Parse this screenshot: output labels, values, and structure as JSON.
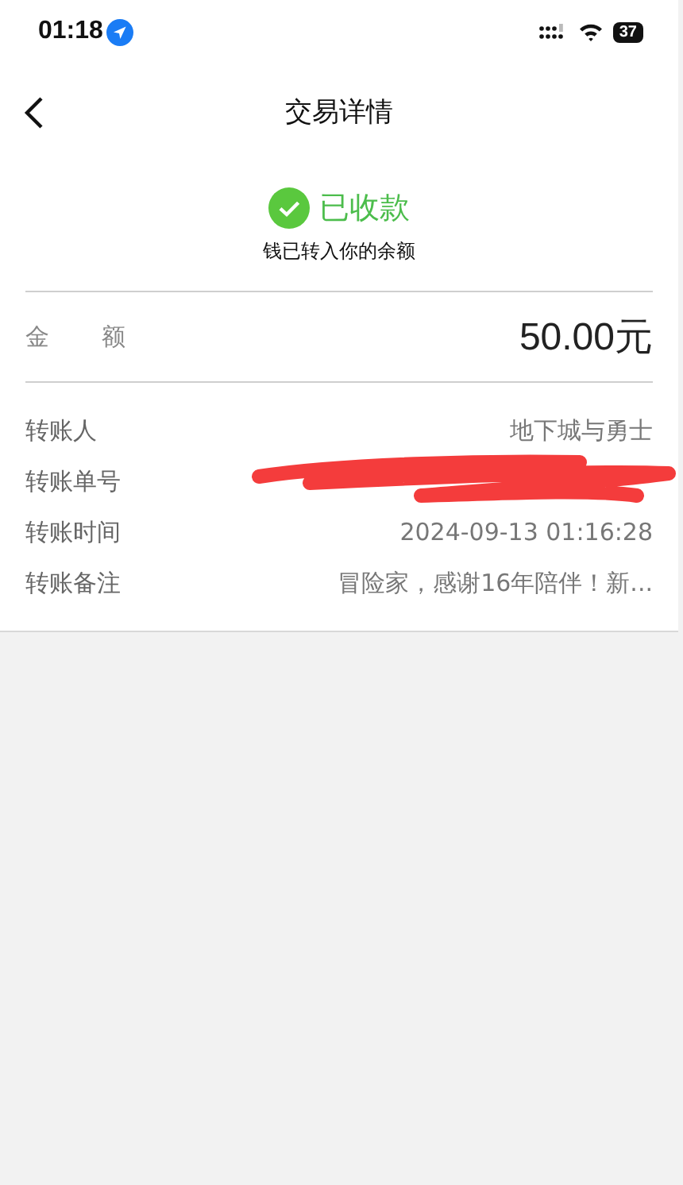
{
  "status_bar": {
    "time": "01:18",
    "battery": "37"
  },
  "nav": {
    "title": "交易详情"
  },
  "status": {
    "label": "已收款",
    "note": "钱已转入你的余额"
  },
  "amount": {
    "label": "金 额",
    "value": "50.00元"
  },
  "details": [
    {
      "kind": "text",
      "label": "转账人",
      "value": "地下城与勇士"
    },
    {
      "kind": "redacted",
      "label": "转账单号"
    },
    {
      "kind": "text",
      "label": "转账时间",
      "value": "2024-09-13 01:16:28"
    },
    {
      "kind": "text",
      "label": "转账备注",
      "value": "冒险家，感谢16年陪伴！新..."
    }
  ]
}
